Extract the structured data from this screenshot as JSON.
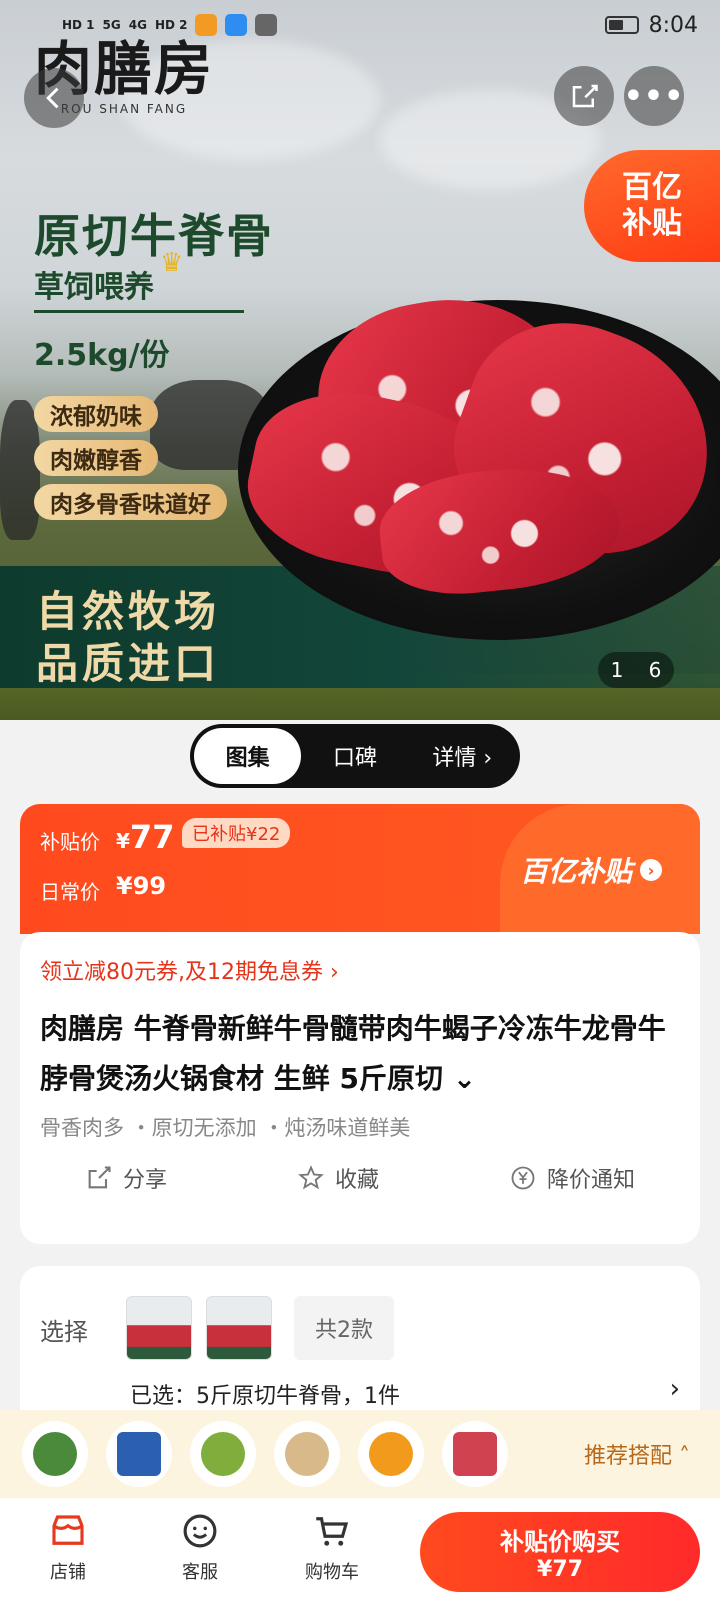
{
  "status_bar": {
    "network_labels": [
      "HD 1",
      "5G",
      "4G",
      "HD 2"
    ],
    "time": "8:04"
  },
  "hero": {
    "brand_name": "肉膳房",
    "brand_sub": "ROU SHAN FANG",
    "subsidy_badge": [
      "百亿",
      "补贴"
    ],
    "title": "原切牛脊骨",
    "tagline": "草饲喂养",
    "weight": "2.5kg/份",
    "pills": [
      "浓郁奶味",
      "肉嫩醇香",
      "肉多骨香味道好"
    ],
    "slogan": [
      "自然牧场",
      "品质进口"
    ],
    "image_counter": {
      "current": "1",
      "total": "6"
    }
  },
  "tabs": [
    {
      "label": "图集",
      "active": true
    },
    {
      "label": "口碑",
      "active": false
    },
    {
      "label": "详情 ›",
      "active": false
    }
  ],
  "price": {
    "subsidy_label": "补贴价",
    "currency": "¥",
    "subsidy_value": "77",
    "saved": "已补贴¥22",
    "daily_label": "日常价",
    "daily_value": "¥99",
    "program": "百亿补贴"
  },
  "info": {
    "coupon": "领立减80元券,及12期免息券 ›",
    "title": "肉膳房 牛脊骨新鲜牛骨髓带肉牛蝎子冷冻牛龙骨牛脖骨煲汤火锅食材 生鲜 5斤原切 ⌄",
    "features": "骨香肉多 ・原切无添加 ・炖汤味道鲜美",
    "actions": {
      "share": "分享",
      "favorite": "收藏",
      "price_alert": "降价通知"
    }
  },
  "select": {
    "label": "选择",
    "variant_count": "共2款",
    "selected": "已选：5斤原切牛脊骨，1件",
    "chevron": "›"
  },
  "recommend": {
    "label": "推荐搭配 ˄",
    "items": [
      "cucumber",
      "seafood-pack",
      "radish-basket",
      "mushroom",
      "orange-cup",
      "meat-pack"
    ]
  },
  "bottom_nav": {
    "shop": "店铺",
    "service": "客服",
    "cart": "购物车",
    "buy_line1": "补贴价购买",
    "buy_line2": "¥77"
  },
  "colors": {
    "accent": "#ff4a1e",
    "subsidy_red": "#e5341a",
    "recommend_bg": "#fdf4df"
  }
}
